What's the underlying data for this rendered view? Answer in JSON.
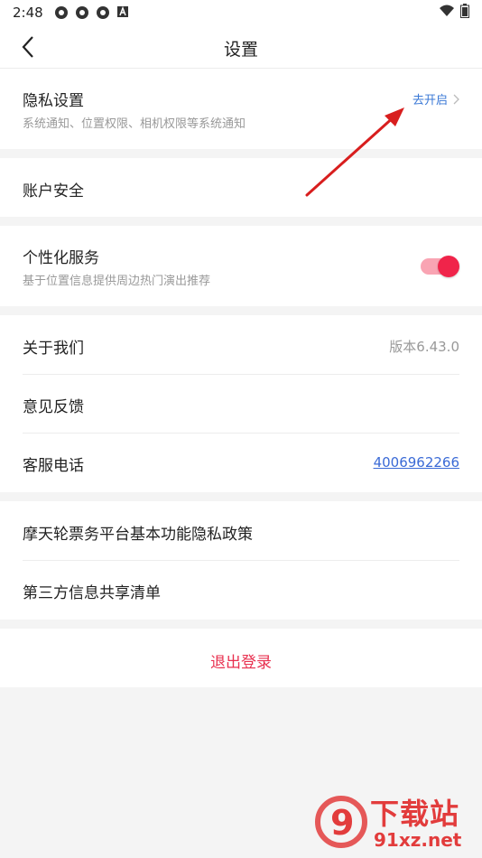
{
  "status_bar": {
    "time": "2:48",
    "icons": [
      "notification-icon",
      "notification-icon",
      "notification-icon",
      "font-icon"
    ],
    "right_icons": [
      "wifi-icon",
      "battery-icon"
    ]
  },
  "nav": {
    "title": "设置",
    "back_icon": "back-arrow-icon"
  },
  "privacy": {
    "title": "隐私设置",
    "subtitle": "系统通知、位置权限、相机权限等系统通知",
    "link": "去开启"
  },
  "account": {
    "title": "账户安全"
  },
  "personalization": {
    "title": "个性化服务",
    "subtitle": "基于位置信息提供周边热门演出推荐",
    "enabled": true
  },
  "about": {
    "title": "关于我们",
    "version": "版本6.43.0"
  },
  "feedback": {
    "title": "意见反馈"
  },
  "service": {
    "title": "客服电话",
    "phone": "4006962266"
  },
  "policy": {
    "title": "摩天轮票务平台基本功能隐私政策"
  },
  "third_party": {
    "title": "第三方信息共享清单"
  },
  "logout": {
    "label": "退出登录"
  },
  "watermark": {
    "line1": "下载站",
    "line2": "91xz.net",
    "logo": "9"
  },
  "colors": {
    "accent": "#e8304f",
    "link": "#3a78d6",
    "background": "#f4f4f4",
    "annotation_arrow": "#d81e1e"
  }
}
